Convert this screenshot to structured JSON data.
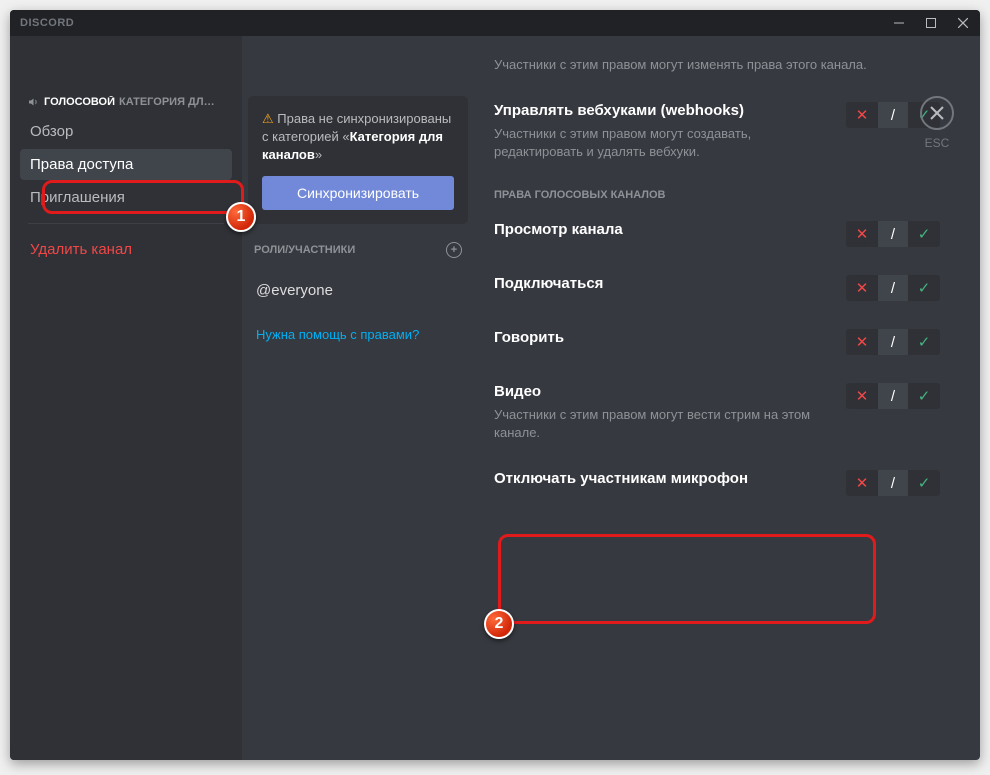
{
  "titlebar": {
    "app_name": "DISCORD"
  },
  "close": {
    "label": "ESC"
  },
  "sidebar": {
    "header_prefix": "ГОЛОСОВОЙ",
    "header_suffix": "КАТЕГОРИЯ ДЛ…",
    "items": [
      {
        "label": "Обзор"
      },
      {
        "label": "Права доступа"
      },
      {
        "label": "Приглашения"
      }
    ],
    "delete_label": "Удалить канал"
  },
  "sync": {
    "text_pre": "Права не синхронизированы с категорией «",
    "text_bold": "Категория для каналов",
    "text_post": "»",
    "button": "Синхронизировать"
  },
  "roles": {
    "header": "РОЛИ/УЧАСТНИКИ",
    "everyone": "@everyone",
    "help": "Нужна помощь с правами?"
  },
  "perms": {
    "top_desc": "Участники с этим правом могут изменять права этого канала.",
    "webhooks_title": "Управлять вебхуками (webhooks)",
    "webhooks_desc": "Участники с этим правом могут создавать, редактировать и удалять вебхуки.",
    "section_header": "ПРАВА ГОЛОСОВЫХ КАНАЛОВ",
    "view_title": "Просмотр канала",
    "connect_title": "Подключаться",
    "speak_title": "Говорить",
    "video_title": "Видео",
    "video_desc": "Участники с этим правом могут вести стрим на этом канале.",
    "mute_title": "Отключать участникам микрофон"
  },
  "toggle": {
    "deny": "✕",
    "neutral": "/",
    "allow": "✓"
  }
}
